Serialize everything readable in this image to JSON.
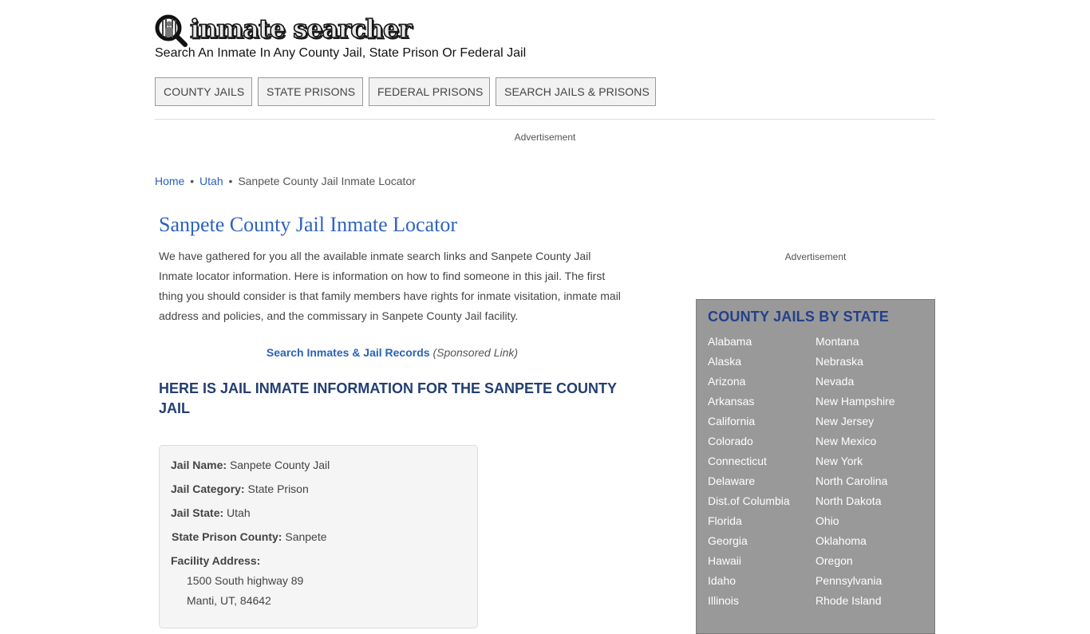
{
  "header": {
    "logo_text": "inmate searcher",
    "logo_icon": "magnifier-inmate-icon",
    "tagline": "Search An Inmate In Any County Jail, State Prison Or Federal Jail"
  },
  "nav": {
    "items": [
      {
        "label": "COUNTY JAILS"
      },
      {
        "label": "STATE PRISONS"
      },
      {
        "label": "FEDERAL PRISONS"
      },
      {
        "label": "SEARCH JAILS & PRISONS"
      }
    ]
  },
  "ads": {
    "top_label": "Advertisement",
    "side_label": "Advertisement"
  },
  "breadcrumb": {
    "items": [
      {
        "label": "Home"
      },
      {
        "label": "Utah"
      },
      {
        "label": "Sanpete County Jail Inmate Locator"
      }
    ],
    "separator": "•"
  },
  "main": {
    "title": "Sanpete County Jail Inmate Locator",
    "intro": "We have gathered for you all the available inmate search links and Sanpete County Jail Inmate locator information. Here is information on how to find someone in this jail. The first thing you should consider is that family members have rights for inmate visitation, inmate mail address and policies, and the commissary in Sanpete County Jail facility.",
    "sponsored_link": "Search Inmates & Jail Records",
    "sponsored_note": "(Sponsored Link)",
    "section_heading": "HERE IS JAIL INMATE INFORMATION FOR THE SANPETE COUNTY JAIL"
  },
  "info": {
    "jail_name_label": "Jail Name:",
    "jail_name": "Sanpete County Jail",
    "category_label": "Jail Category:",
    "category": "State Prison",
    "state_label": "Jail State:",
    "state": "Utah",
    "county_label": "State Prison County:",
    "county": "Sanpete",
    "address_label": "Facility Address:",
    "address_line1": "1500 South highway 89",
    "address_line2": "Manti, UT, 84642"
  },
  "sidebar": {
    "title": "COUNTY JAILS BY STATE",
    "left": [
      "Alabama",
      "Alaska",
      "Arizona",
      "Arkansas",
      "California",
      "Colorado",
      "Connecticut",
      "Delaware",
      "Dist.of Columbia",
      "Florida",
      "Georgia",
      "Hawaii",
      "Idaho",
      "Illinois"
    ],
    "right": [
      "Montana",
      "Nebraska",
      "Nevada",
      "New Hampshire",
      "New Jersey",
      "New Mexico",
      "New York",
      "North Carolina",
      "North Dakota",
      "Ohio",
      "Oklahoma",
      "Oregon",
      "Pennsylvania",
      "Rhode Island"
    ]
  },
  "colors": {
    "link": "#2a62b9",
    "title": "#2f63c0",
    "heading": "#233e72",
    "sidebar_bg": "#999999",
    "sidebar_title": "#24408a"
  }
}
